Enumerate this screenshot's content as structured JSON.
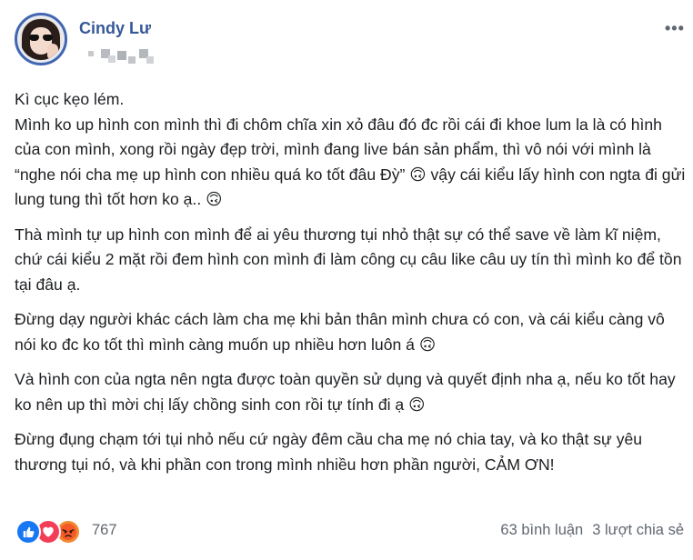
{
  "post": {
    "author": "Cindy Lư",
    "paragraphs": [
      "Kì cục kẹo lém.\nMình ko up hình con mình thì đi chôm chĩa xin xỏ đâu đó đc rồi cái đi khoe lum la là có hình của con mình, xong rồi ngày đẹp trời, mình đang live bán sản phẩm, thì vô nói với mình là “nghe nói cha mẹ up hình con nhiều quá ko tốt đâu Đỳ” 🙃 vậy cái kiểu lấy hình con ngta đi gửi lung tung thì tốt hơn ko ạ.. 🙃",
      "Thà mình tự up hình con mình để ai yêu thương tụi nhỏ thật sự có thể save về làm kĩ niệm, chứ cái kiểu 2 mặt rồi đem hình con mình đi làm công cụ câu like câu uy tín thì mình ko để tồn tại đâu ạ.",
      "Đừng dạy người khác cách làm cha mẹ khi bản thân mình chưa có con, và cái kiểu càng vô nói ko đc ko tốt thì mình càng muốn up nhiều hơn luôn á 🙃",
      "Và hình con của ngta nên ngta được toàn quyền sử dụng và quyết định nha ạ, nếu ko tốt hay ko nên up thì mời chị lấy chồng sinh con rồi tự tính đi ạ 🙃",
      "Đừng đụng chạm tới tụi nhỏ nếu cứ ngày đêm cầu cha mẹ nó chia tay, và ko thật sự yêu thương tụi nó, và khi phần con trong mình nhiều hơn phần người, CẢM ƠN!"
    ]
  },
  "footer": {
    "reaction_count": "767",
    "comments": "63 bình luận",
    "shares": "3 lượt chia sẻ"
  },
  "icons": {
    "menu": "more-horizontal-icon",
    "reactions": [
      "like-icon",
      "love-icon",
      "angry-icon"
    ]
  },
  "colors": {
    "author_link": "#365899",
    "avatar_ring": "#4267b2",
    "like": "#1877f2",
    "love": "#f33e58",
    "angry": "#f08a2e"
  }
}
